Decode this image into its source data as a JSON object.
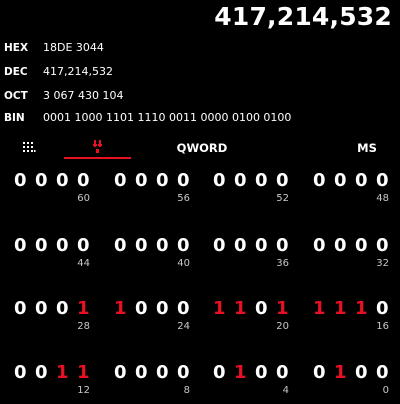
{
  "display": {
    "value": "417,214,532"
  },
  "radix": [
    {
      "label": "HEX",
      "value": "18DE 3044"
    },
    {
      "label": "DEC",
      "value": "417,214,532"
    },
    {
      "label": "OCT",
      "value": "3 067 430 104"
    },
    {
      "label": "BIN",
      "value": "0001 1000 1101 1110 0011 0000 0100 0100"
    }
  ],
  "toolbar": {
    "keypad_icon": "full-keypad-icon",
    "bitflip_icon": "bit-toggle-keypad-icon",
    "word_size_label": "QWORD",
    "memory_label": "MS"
  },
  "colors": {
    "background": "#000000",
    "text": "#ffffff",
    "bit_on": "#e81123",
    "accent_underline": "#e81123"
  },
  "bit_rows": [
    {
      "groups": [
        {
          "bits": [
            "0",
            "0",
            "0",
            "0"
          ],
          "position": "60"
        },
        {
          "bits": [
            "0",
            "0",
            "0",
            "0"
          ],
          "position": "56"
        },
        {
          "bits": [
            "0",
            "0",
            "0",
            "0"
          ],
          "position": "52"
        },
        {
          "bits": [
            "0",
            "0",
            "0",
            "0"
          ],
          "position": "48"
        }
      ]
    },
    {
      "groups": [
        {
          "bits": [
            "0",
            "0",
            "0",
            "0"
          ],
          "position": "44"
        },
        {
          "bits": [
            "0",
            "0",
            "0",
            "0"
          ],
          "position": "40"
        },
        {
          "bits": [
            "0",
            "0",
            "0",
            "0"
          ],
          "position": "36"
        },
        {
          "bits": [
            "0",
            "0",
            "0",
            "0"
          ],
          "position": "32"
        }
      ]
    },
    {
      "groups": [
        {
          "bits": [
            "0",
            "0",
            "0",
            "1"
          ],
          "position": "28"
        },
        {
          "bits": [
            "1",
            "0",
            "0",
            "0"
          ],
          "position": "24"
        },
        {
          "bits": [
            "1",
            "1",
            "0",
            "1"
          ],
          "position": "20"
        },
        {
          "bits": [
            "1",
            "1",
            "1",
            "0"
          ],
          "position": "16"
        }
      ]
    },
    {
      "groups": [
        {
          "bits": [
            "0",
            "0",
            "1",
            "1"
          ],
          "position": "12"
        },
        {
          "bits": [
            "0",
            "0",
            "0",
            "0"
          ],
          "position": "8"
        },
        {
          "bits": [
            "0",
            "1",
            "0",
            "0"
          ],
          "position": "4"
        },
        {
          "bits": [
            "0",
            "1",
            "0",
            "0"
          ],
          "position": "0"
        }
      ]
    }
  ]
}
